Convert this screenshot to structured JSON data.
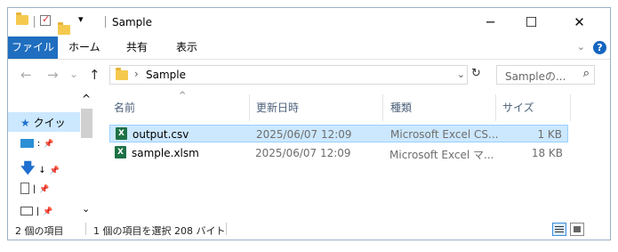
{
  "window": {
    "title": "Sample"
  },
  "title_controls": {
    "minimize": "─",
    "maximize": "☐",
    "close": "✕",
    "qa_dropdown": "▾"
  },
  "ribbon": {
    "tabs": [
      "ファイル",
      "ホーム",
      "共有",
      "表示"
    ],
    "accent": "#1f6ebf",
    "collapse_icon": "⌄",
    "help_icon": "?"
  },
  "nav": {
    "back": "←",
    "forward": "→",
    "recent": "⌄",
    "up": "↑",
    "breadcrumb_arrow": "›",
    "breadcrumb": "Sample",
    "address_dropdown": "⌄",
    "refresh": "↻",
    "search_placeholder": "Sampleの...",
    "search_icon": "⌕"
  },
  "navpane": {
    "scroll_up": "^",
    "scroll_down": "⌄",
    "items": [
      {
        "label": "クイッ",
        "icon": "star-icon"
      },
      {
        "label": ":",
        "icon": "desktop-icon"
      },
      {
        "label": "↓",
        "icon": "download-icon"
      },
      {
        "label": "|",
        "icon": "document-icon"
      },
      {
        "label": "|",
        "icon": "pictures-icon"
      }
    ],
    "pin": "📌"
  },
  "columns": {
    "name": "名前",
    "date": "更新日時",
    "type": "種類",
    "size": "サイズ",
    "sort_indicator": "^"
  },
  "files": [
    {
      "icon": "excel-csv-icon",
      "name": "output.csv",
      "date": "2025/06/07 12:09",
      "type": "Microsoft Excel CS...",
      "size": "1 KB",
      "selected": true
    },
    {
      "icon": "excel-xlsm-icon",
      "name": "sample.xlsm",
      "date": "2025/06/07 12:09",
      "type": "Microsoft Excel マ...",
      "size": "18 KB",
      "selected": false
    }
  ],
  "status": {
    "item_count": "2 個の項目",
    "selection": "1 個の項目を選択",
    "selection_size": "208 バイト"
  },
  "colors": {
    "selection_bg": "#cce8ff",
    "selection_border": "#99d1ff",
    "folder": "#f5c94d",
    "excel_green": "#1e7145"
  }
}
